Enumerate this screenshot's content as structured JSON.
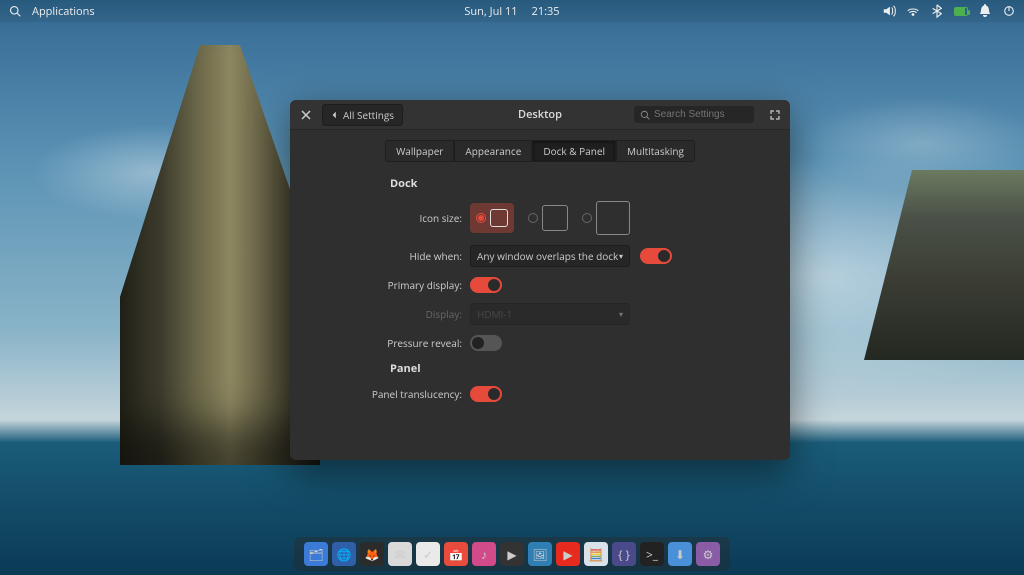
{
  "panel": {
    "apps_label": "Applications",
    "date": "Sun, Jul 11",
    "time": "21:35"
  },
  "window": {
    "all_settings": "All Settings",
    "title": "Desktop",
    "search_placeholder": "Search Settings",
    "tabs": {
      "wallpaper": "Wallpaper",
      "appearance": "Appearance",
      "dock_panel": "Dock & Panel",
      "multitasking": "Multitasking"
    },
    "sections": {
      "dock": "Dock",
      "panel": "Panel"
    },
    "labels": {
      "icon_size": "Icon size:",
      "hide_when": "Hide when:",
      "primary_display": "Primary display:",
      "display": "Display:",
      "pressure_reveal": "Pressure reveal:",
      "panel_translucency": "Panel translucency:"
    },
    "values": {
      "hide_when": "Any window overlaps the dock",
      "display": "HDMI-1"
    },
    "toggles": {
      "hide_when": true,
      "primary_display": true,
      "pressure_reveal": false,
      "panel_translucency": true
    },
    "icon_size_selected": 0
  },
  "dock_items": [
    {
      "name": "files",
      "color": "#3b7ad6",
      "glyph": "🗂"
    },
    {
      "name": "browser-epiphany",
      "color": "#2f5fa6",
      "glyph": "🌐"
    },
    {
      "name": "browser-firefox",
      "color": "#2b2b2b",
      "glyph": "🦊"
    },
    {
      "name": "mail",
      "color": "#d9d9d9",
      "glyph": "✉"
    },
    {
      "name": "tasks",
      "color": "#eaeaea",
      "glyph": "✓"
    },
    {
      "name": "calendar",
      "color": "#e74c3c",
      "glyph": "📅"
    },
    {
      "name": "music",
      "color": "#d14a8a",
      "glyph": "♪"
    },
    {
      "name": "videos",
      "color": "#333",
      "glyph": "▶"
    },
    {
      "name": "photos",
      "color": "#2f7fb5",
      "glyph": "🖼"
    },
    {
      "name": "youtube",
      "color": "#e62b1e",
      "glyph": "▶"
    },
    {
      "name": "calculator",
      "color": "#d9e2ea",
      "glyph": "🧮"
    },
    {
      "name": "code",
      "color": "#4a4a8a",
      "glyph": "{ }"
    },
    {
      "name": "terminal",
      "color": "#222",
      "glyph": ">_"
    },
    {
      "name": "appcenter",
      "color": "#4a90d9",
      "glyph": "⬇"
    },
    {
      "name": "settings",
      "color": "#8a5ca6",
      "glyph": "⚙"
    }
  ],
  "colors": {
    "accent": "#e64a3b",
    "window_bg": "#2f2f2f"
  }
}
